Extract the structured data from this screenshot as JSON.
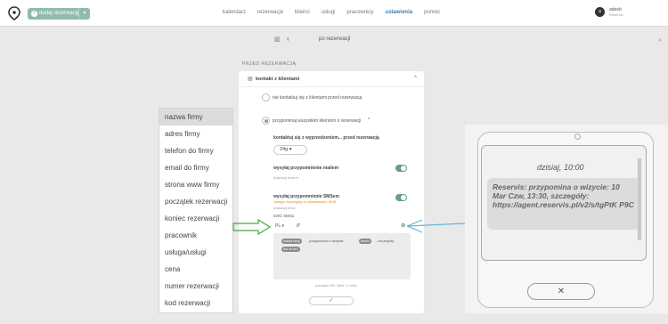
{
  "topbar": {
    "add_button": "dodaj rezerwację",
    "nav": [
      "kalendarz",
      "rezerwacje",
      "klienci",
      "usługi",
      "pracownicy",
      "ustawienia",
      "pomoc"
    ],
    "active_nav": "ustawienia",
    "user": {
      "initial": "a",
      "name": "adeeb",
      "company": "Reservis"
    }
  },
  "subbar": {
    "title": "po rezerwacji"
  },
  "section_label": "PRZED REZERWACJĄ",
  "card": {
    "title": "kontakt z klientami",
    "option_no": "nie kontaktuj się z klientami przed rezerwacją",
    "option_yes": "przypominaj wszystkim klientom o rezerwacji",
    "contact_before": "kontaktuj się z wyprzedzeniem... przed rezerwacją",
    "hours_value": "24g",
    "email_toggle": "wysyłaj przypomnienie mailem",
    "email_more": "dostosuj treść",
    "sms_toggle": "wysyłaj przypomnienie SMSem",
    "sms_warning": "Uwaga: szczegóły w ustawieniach SMS",
    "sms_more": "dostosuj treść",
    "sms_content_label": "treść SMSu",
    "sms_lang": "PL",
    "message_text": ", przypomina o wizycie:",
    "message_text2": ", szczegóły:",
    "chips": [
      "nazwa firmy",
      "termin",
      "link do rez."
    ],
    "counter": "pozostało 100 / (limit 1 = sms)"
  },
  "dropdown_items": [
    "nazwa firmy",
    "adres firmy",
    "telefon do firmy",
    "email do firmy",
    "strona www firmy",
    "początek rezerwacji",
    "koniec rezerwacji",
    "pracownik",
    "usługa/usługi",
    "cena",
    "numer rezerwacji",
    "kod rezerwacji"
  ],
  "dropdown_selected": "nazwa firmy",
  "phone": {
    "time": "dzisiaj, 10:00",
    "sms_body": "Reservis: przypomina o wizycie: 10 Mar Czw, 13:30, szczegóły: https://agent.reservis.pl/v2/s/tgPtK P9C",
    "close": "✕"
  },
  "colors": {
    "accent_green": "#8fbca8",
    "toggle_green": "#6b9c84",
    "arrow_green": "#3fae3f",
    "arrow_blue": "#5fb8d8",
    "active_nav": "#3a7fb4"
  }
}
